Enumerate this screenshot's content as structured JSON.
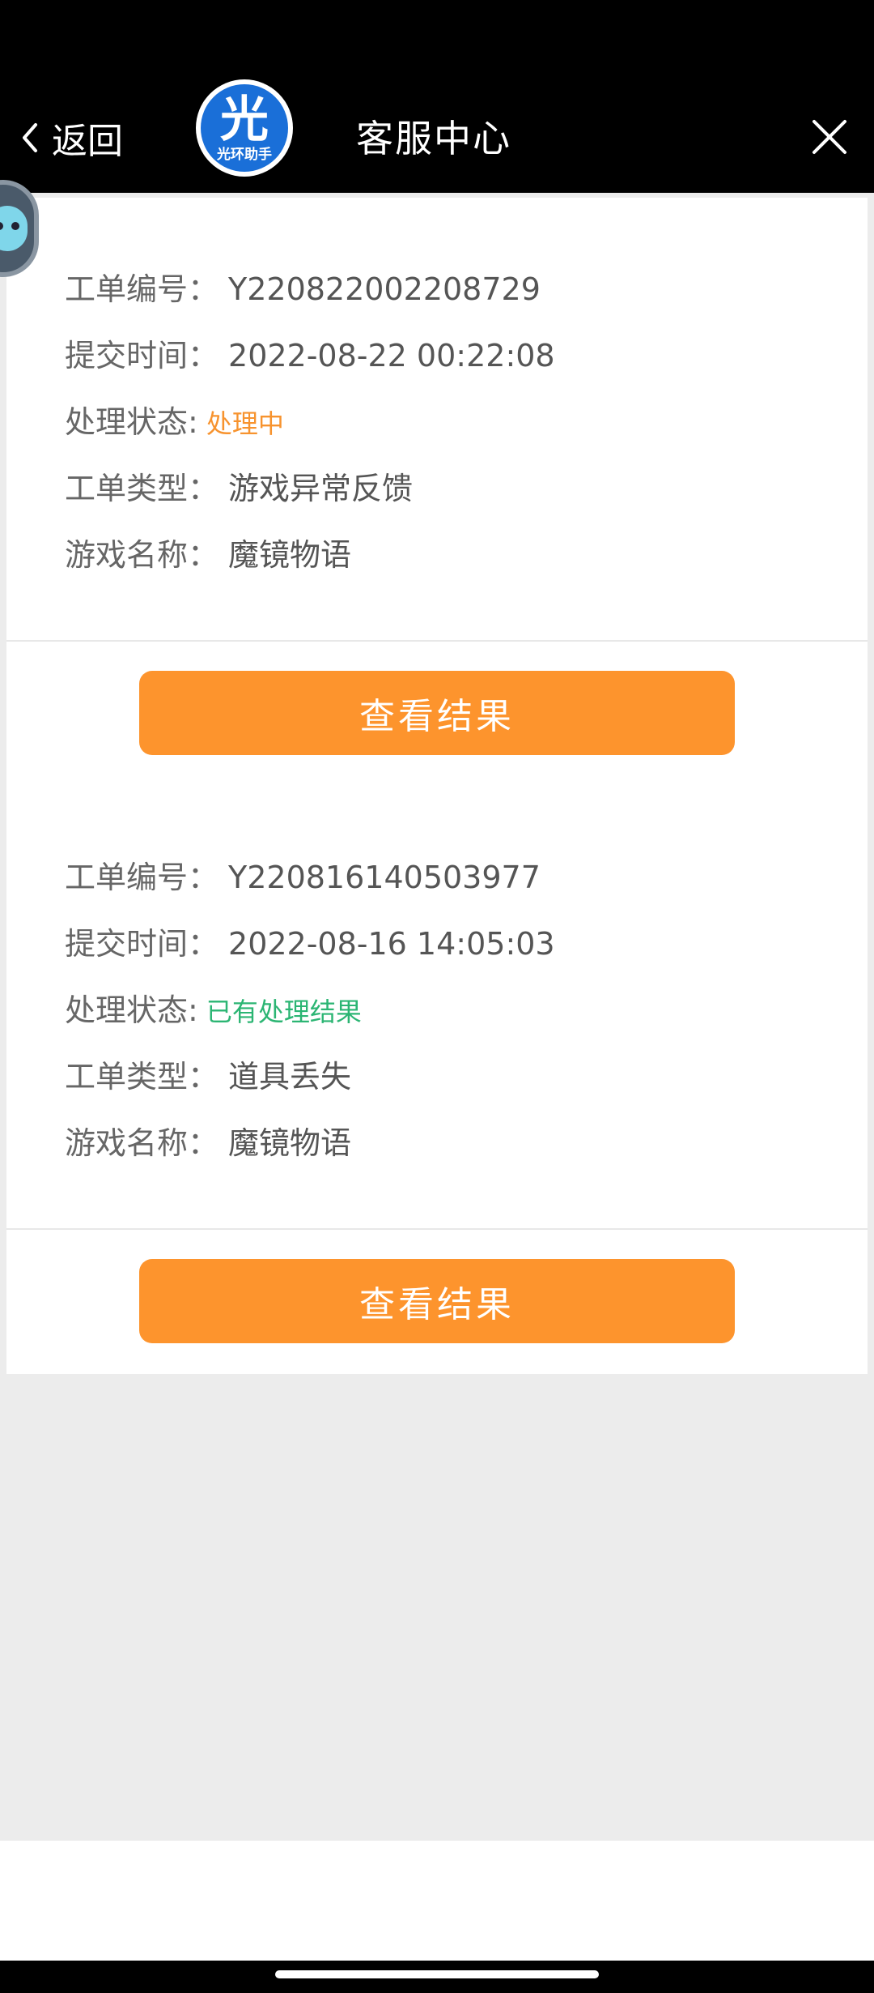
{
  "header": {
    "back_label": "返回",
    "logo_char": "光",
    "logo_text": "光环助手",
    "title": "客服中心"
  },
  "tickets": [
    {
      "id_label": "工单编号：",
      "id": "Y220822002208729",
      "time_label": "提交时间：",
      "time": "2022-08-22 00:22:08",
      "status_label": "处理状态:",
      "status": "处理中",
      "type_label": "工单类型：",
      "type": "游戏异常反馈",
      "game_label": "游戏名称：",
      "game": "魔镜物语",
      "button_label": "查看结果"
    },
    {
      "id_label": "工单编号：",
      "id": "Y220816140503977",
      "time_label": "提交时间：",
      "time": "2022-08-16 14:05:03",
      "status_label": "处理状态:",
      "status": "已有处理结果",
      "type_label": "工单类型：",
      "type": "道具丢失",
      "game_label": "游戏名称：",
      "game": "魔镜物语",
      "button_label": "查看结果"
    }
  ],
  "colors": {
    "accent": "#fd942d",
    "status_processing": "#f7932e",
    "status_done": "#2bb573",
    "logo": "#1a6fd8"
  },
  "icons": [
    "chevron-left-icon",
    "close-icon",
    "floating-assistant-icon"
  ]
}
